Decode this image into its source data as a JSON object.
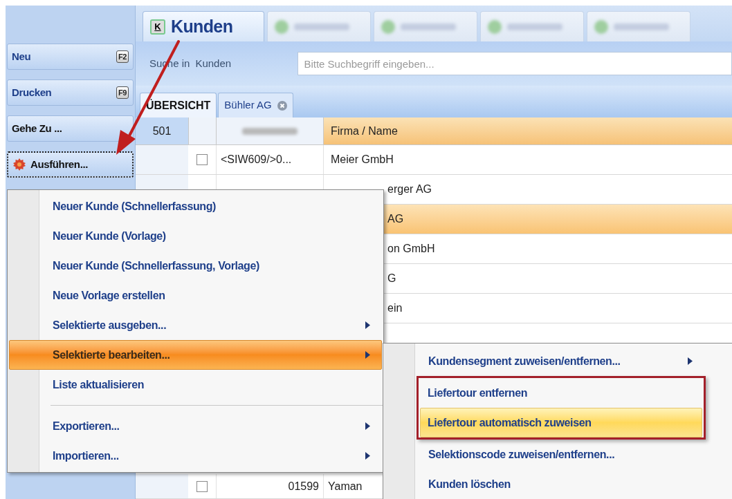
{
  "module_tabs": [
    {
      "kind": "named",
      "key": "K",
      "label": "Kunden",
      "selected": true
    },
    {
      "kind": "blurred",
      "selected": false
    },
    {
      "kind": "blurred",
      "selected": false
    },
    {
      "kind": "blurred",
      "selected": false
    },
    {
      "kind": "blurred",
      "selected": false
    }
  ],
  "sidebar": {
    "buttons": [
      {
        "kind": "shortcut",
        "label": "Neu",
        "shortcut": "F2",
        "focused": false
      },
      {
        "kind": "shortcut",
        "label": "Drucken",
        "shortcut": "F9",
        "focused": false
      },
      {
        "kind": "plain",
        "label": "Gehe Zu ...",
        "focused": false
      },
      {
        "kind": "gear",
        "label": "Ausführen...",
        "focused": true
      }
    ]
  },
  "search": {
    "label": "Suche in",
    "scope": "Kunden",
    "placeholder": "Bitte Suchbegriff eingeben..."
  },
  "view_tabs": [
    {
      "label": "ÜBERSICHT",
      "selected": true,
      "closable": false
    },
    {
      "label": "Bühler AG",
      "selected": false,
      "closable": true
    }
  ],
  "table": {
    "count": "501",
    "columns": [
      {
        "kind": "check"
      },
      {
        "kind": "blurred"
      },
      {
        "kind": "text",
        "label": "Firma / Name",
        "sorted": true
      }
    ],
    "rows": [
      {
        "checked": false,
        "code": "<SIW609/>0...",
        "name": "Meier GmbH",
        "selected": false
      },
      {
        "name": "erger AG",
        "selected": false,
        "covered": true
      },
      {
        "name": "AG",
        "selected": true,
        "covered": true
      },
      {
        "name": "on GmbH",
        "selected": false,
        "covered": true
      },
      {
        "name": "G",
        "selected": false,
        "covered": true
      },
      {
        "name": "ein",
        "selected": false,
        "covered": true
      }
    ],
    "rows_below_menu": [
      {
        "checked": false,
        "code": "01599",
        "name": "Yaman",
        "selected": false
      }
    ]
  },
  "context_menu": {
    "items": [
      {
        "kind": "item",
        "label": "Neuer Kunde (Schnellerfassung)",
        "submenu": false,
        "selected": false
      },
      {
        "kind": "item",
        "label": "Neuer Kunde (Vorlage)",
        "submenu": false,
        "selected": false
      },
      {
        "kind": "item",
        "label": "Neuer Kunde (Schnellerfassung, Vorlage)",
        "submenu": false,
        "selected": false
      },
      {
        "kind": "item",
        "label": "Neue Vorlage erstellen",
        "submenu": false,
        "selected": false
      },
      {
        "kind": "item",
        "label": "Selektierte ausgeben...",
        "submenu": true,
        "selected": false
      },
      {
        "kind": "item",
        "label": "Selektierte bearbeiten...",
        "submenu": true,
        "selected": true
      },
      {
        "kind": "item",
        "label": "Liste aktualisieren",
        "submenu": false,
        "selected": false
      },
      {
        "kind": "separator"
      },
      {
        "kind": "item",
        "label": "Exportieren...",
        "submenu": true,
        "selected": false
      },
      {
        "kind": "item",
        "label": "Importieren...",
        "submenu": true,
        "selected": false
      }
    ]
  },
  "submenu": {
    "items": [
      {
        "label": "Kundensegment zuweisen/entfernen...",
        "submenu": true,
        "selected": false,
        "highlighted": false
      },
      {
        "label": "Liefertour entfernen",
        "submenu": false,
        "selected": false,
        "highlighted": true
      },
      {
        "label": "Liefertour automatisch zuweisen",
        "submenu": false,
        "selected": true,
        "highlighted": true
      },
      {
        "label": "Selektionscode zuweisen/entfernen...",
        "submenu": false,
        "selected": false,
        "highlighted": false
      },
      {
        "label": "Kunden löschen",
        "submenu": false,
        "selected": false,
        "highlighted": false
      }
    ]
  }
}
